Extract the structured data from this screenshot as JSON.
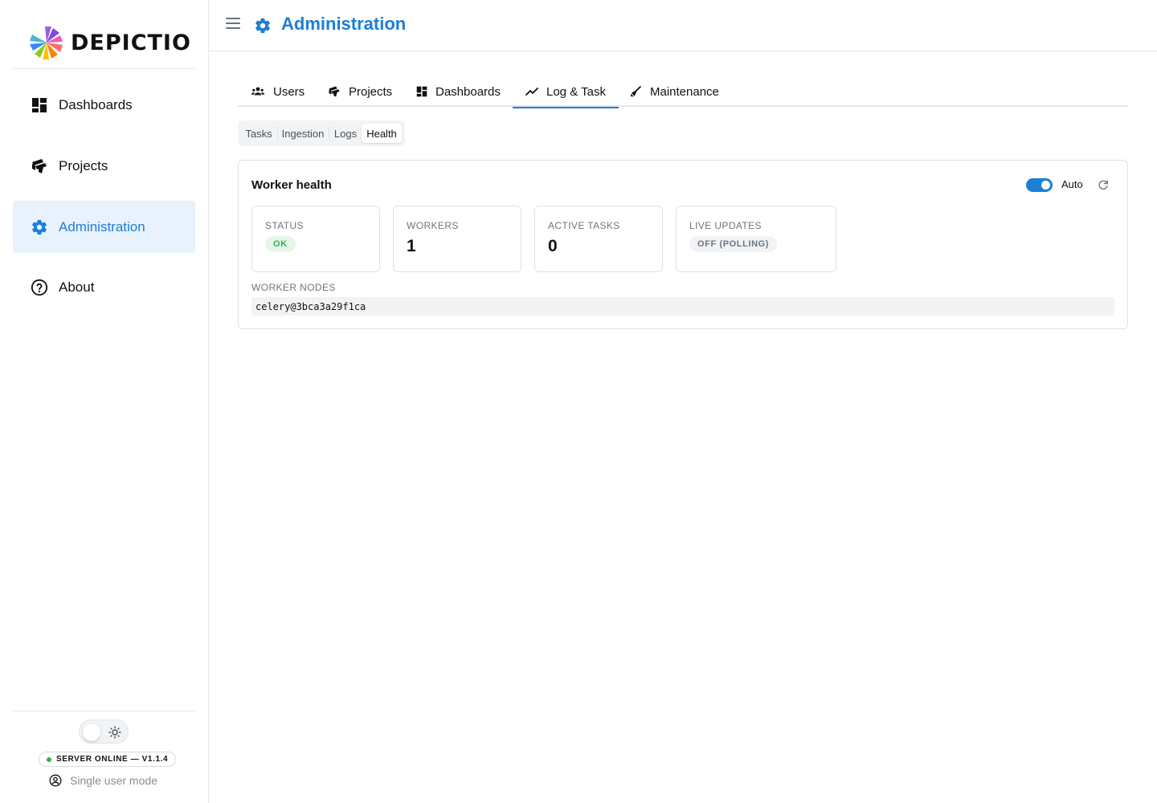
{
  "app": {
    "logo_text": "DEPICTIO"
  },
  "sidebar": {
    "items": [
      {
        "label": "Dashboards",
        "icon": "dashboard-grid-icon",
        "active": false
      },
      {
        "label": "Projects",
        "icon": "projects-icon",
        "active": false
      },
      {
        "label": "Administration",
        "icon": "gear-icon",
        "active": true
      },
      {
        "label": "About",
        "icon": "question-circle-icon",
        "active": false
      }
    ],
    "server_status": "SERVER ONLINE — V1.1.4",
    "user_mode": "Single user mode"
  },
  "header": {
    "title": "Administration"
  },
  "tabs": [
    {
      "label": "Users",
      "icon": "users-icon"
    },
    {
      "label": "Projects",
      "icon": "projects-icon"
    },
    {
      "label": "Dashboards",
      "icon": "dashboard-grid-icon"
    },
    {
      "label": "Log & Task",
      "icon": "trend-line-icon",
      "active": true
    },
    {
      "label": "Maintenance",
      "icon": "broom-icon"
    }
  ],
  "subtabs": [
    {
      "label": "Tasks"
    },
    {
      "label": "Ingestion"
    },
    {
      "label": "Logs"
    },
    {
      "label": "Health",
      "active": true
    }
  ],
  "health": {
    "title": "Worker health",
    "auto_label": "Auto",
    "auto_enabled": true,
    "stats": {
      "status": {
        "label": "STATUS",
        "value": "OK"
      },
      "workers": {
        "label": "WORKERS",
        "value": "1"
      },
      "active_tasks": {
        "label": "ACTIVE TASKS",
        "value": "0"
      },
      "live_updates": {
        "label": "LIVE UPDATES",
        "value": "OFF (POLLING)"
      }
    },
    "nodes_label": "WORKER NODES",
    "nodes": [
      "celery@3bca3a29f1ca"
    ]
  },
  "colors": {
    "accent": "#1c7ed6",
    "active_nav_bg": "#e7f2fc",
    "ok_green": "#2fb344"
  }
}
